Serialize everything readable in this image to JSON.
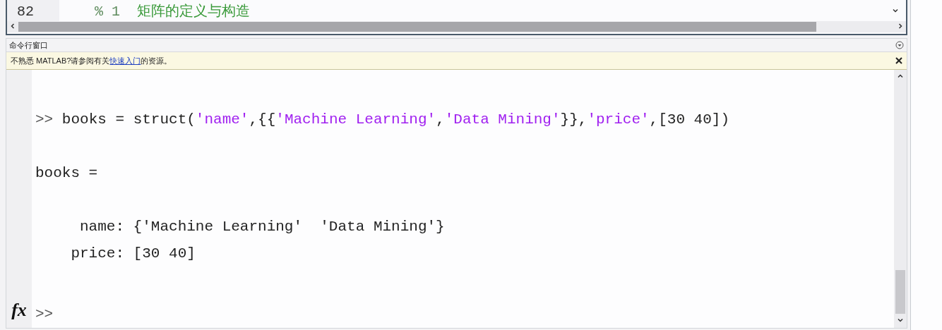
{
  "editor": {
    "line_number": "82",
    "line_text": [
      {
        "kind": "comment",
        "text": "% 1  "
      },
      {
        "kind": "heading",
        "text": "矩阵的定义与构造"
      }
    ]
  },
  "command_window": {
    "title": "命令行窗口",
    "notice": {
      "text_before": "不熟悉 MATLAB?请参阅有关",
      "link": "快速入门",
      "text_after": "的资源。"
    },
    "lines": [
      {
        "kind": "input",
        "prompt": ">>",
        "segments": [
          {
            "kind": "plain",
            "text": "books = struct("
          },
          {
            "kind": "string",
            "text": "'name'"
          },
          {
            "kind": "plain",
            "text": ",{{"
          },
          {
            "kind": "string",
            "text": "'Machine Learning'"
          },
          {
            "kind": "plain",
            "text": ","
          },
          {
            "kind": "string",
            "text": "'Data Mining'"
          },
          {
            "kind": "plain",
            "text": "}},"
          },
          {
            "kind": "string",
            "text": "'price'"
          },
          {
            "kind": "plain",
            "text": ",[30 40])"
          }
        ]
      },
      {
        "kind": "output",
        "text": "books ="
      },
      {
        "kind": "output",
        "text": "     name: {'Machine Learning'  'Data Mining'}"
      },
      {
        "kind": "output",
        "text": "    price: [30 40]"
      }
    ],
    "prompt": ">>",
    "function_button": "fx"
  }
}
